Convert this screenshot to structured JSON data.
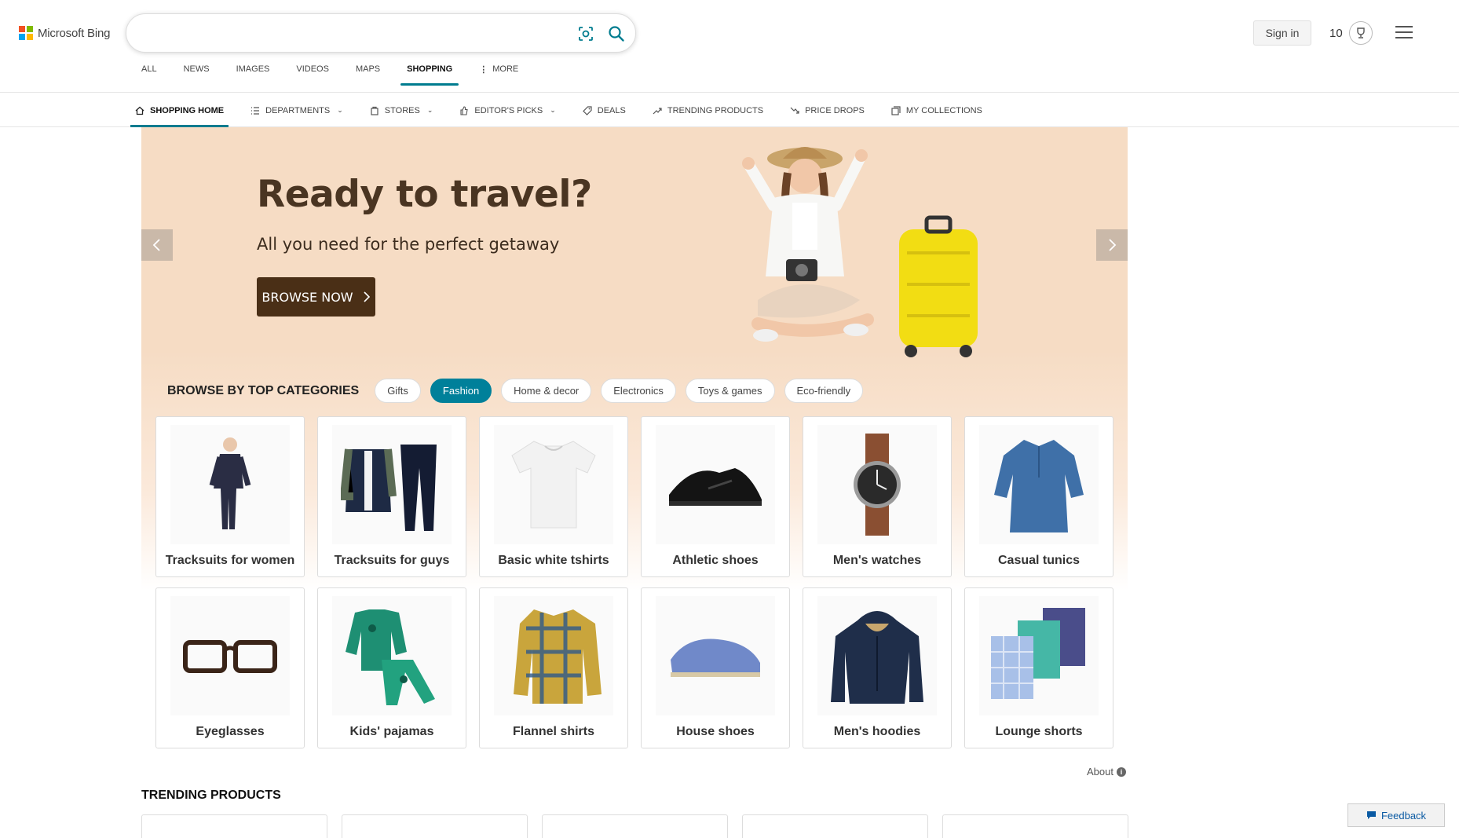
{
  "header": {
    "logo_text": "Microsoft Bing",
    "search": {
      "value": "",
      "placeholder": ""
    },
    "nav_tabs": [
      {
        "label": "ALL",
        "active": false
      },
      {
        "label": "NEWS",
        "active": false
      },
      {
        "label": "IMAGES",
        "active": false
      },
      {
        "label": "VIDEOS",
        "active": false
      },
      {
        "label": "MAPS",
        "active": false
      },
      {
        "label": "SHOPPING",
        "active": true
      },
      {
        "label": "MORE",
        "active": false
      }
    ],
    "sign_in": "Sign in",
    "rewards_points": "10",
    "accent_color": "#007c8f"
  },
  "subnav": [
    {
      "label": "SHOPPING HOME",
      "icon": "home-icon",
      "active": true
    },
    {
      "label": "DEPARTMENTS",
      "icon": "list-icon",
      "dropdown": true
    },
    {
      "label": "STORES",
      "icon": "store-icon",
      "dropdown": true
    },
    {
      "label": "EDITOR'S PICKS",
      "icon": "thumbs-up-icon",
      "dropdown": true
    },
    {
      "label": "DEALS",
      "icon": "tag-icon"
    },
    {
      "label": "TRENDING PRODUCTS",
      "icon": "trending-icon"
    },
    {
      "label": "PRICE DROPS",
      "icon": "price-drop-icon"
    },
    {
      "label": "MY COLLECTIONS",
      "icon": "collections-icon"
    }
  ],
  "hero": {
    "title": "Ready to travel?",
    "subtitle": "All you need for the perfect getaway",
    "button_label": "BROWSE NOW"
  },
  "categories": {
    "title": "BROWSE BY TOP CATEGORIES",
    "pills": [
      {
        "label": "Gifts",
        "active": false
      },
      {
        "label": "Fashion",
        "active": true
      },
      {
        "label": "Home & decor",
        "active": false
      },
      {
        "label": "Electronics",
        "active": false
      },
      {
        "label": "Toys & games",
        "active": false
      },
      {
        "label": "Eco-friendly",
        "active": false
      }
    ],
    "items": [
      {
        "label": "Tracksuits for women",
        "icon": "tracksuit-women-image"
      },
      {
        "label": "Tracksuits for guys",
        "icon": "tracksuit-men-image"
      },
      {
        "label": "Basic white tshirts",
        "icon": "white-tshirt-image"
      },
      {
        "label": "Athletic shoes",
        "icon": "athletic-shoe-image"
      },
      {
        "label": "Men's watches",
        "icon": "watch-image"
      },
      {
        "label": "Casual tunics",
        "icon": "tunic-image"
      },
      {
        "label": "Eyeglasses",
        "icon": "eyeglasses-image"
      },
      {
        "label": "Kids' pajamas",
        "icon": "pajamas-image"
      },
      {
        "label": "Flannel shirts",
        "icon": "flannel-shirt-image"
      },
      {
        "label": "House shoes",
        "icon": "house-shoe-image"
      },
      {
        "label": "Men's hoodies",
        "icon": "hoodie-image"
      },
      {
        "label": "Lounge shorts",
        "icon": "lounge-shorts-image"
      }
    ]
  },
  "about_label": "About",
  "trending_title": "TRENDING PRODUCTS",
  "feedback_label": "Feedback"
}
